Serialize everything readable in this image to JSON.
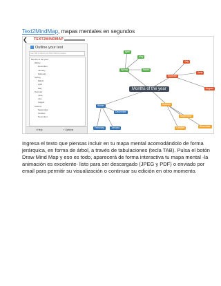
{
  "heading": {
    "link": "Text2MindMap",
    "rest": ", mapas mentales en segundos"
  },
  "app": {
    "logo": "TEXT2MINDMAP",
    "panel_title": "Outline your text",
    "hint": "Use TAB to indent and Shift+TAB to unindent",
    "outline": [
      "Months of the year",
      "Winter",
      "December",
      "January",
      "February",
      "Spring",
      "March",
      "April",
      "May",
      "Summer",
      "June",
      "July",
      "August",
      "Autumn",
      "September",
      "October",
      "November"
    ],
    "footer": {
      "help": "Help",
      "options": "Options"
    }
  },
  "map": {
    "root": "Months of the year",
    "branches": [
      {
        "name": "Spring",
        "color": "#58b14c",
        "children": [
          "April",
          "May",
          "March"
        ]
      },
      {
        "name": "Summer",
        "color": "#e0542e",
        "children": [
          "July",
          "June",
          "August"
        ]
      },
      {
        "name": "Winter",
        "color": "#2f6fb3",
        "children": [
          "December",
          "February",
          "January"
        ]
      },
      {
        "name": "Autumn",
        "color": "#f2a531",
        "children": [
          "September",
          "October",
          "November"
        ]
      }
    ]
  },
  "paragraph": "Ingresa el texto que piensas incluir en tu mapa mental acomodándolo de forma jerárquica, en forma de árbol, a través de tabulaciones (tecla TAB). Pulsa el botón Draw Mind Map y eso es todo, aparecerá de forma interactiva tu mapa mental -la animación es excelente- listo para ser descargado (JPEG y PDF) o enviado por email para permitir su visualización o continuar su edición en otro momento."
}
